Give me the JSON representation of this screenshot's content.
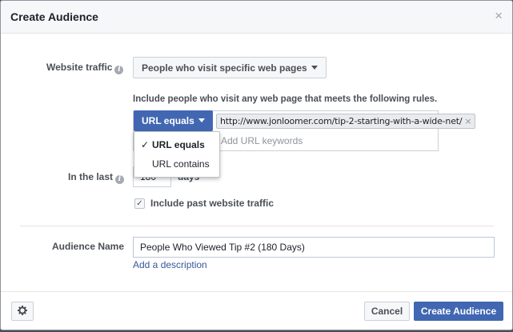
{
  "dialog": {
    "title": "Create Audience",
    "close": "×"
  },
  "website_traffic": {
    "label": "Website traffic",
    "select_value": "People who visit specific web pages"
  },
  "rules": {
    "hint": "Include people who visit any web page that meets the following rules.",
    "operator": "URL equals",
    "url_chip": "http://www.jonloomer.com/tip-2-starting-with-a-wide-net/",
    "chip_remove": "×",
    "keyword_placeholder": "Add URL keywords",
    "dropdown": {
      "options": [
        {
          "label": "URL equals",
          "checked": true
        },
        {
          "label": "URL contains",
          "checked": false
        }
      ]
    }
  },
  "in_the_last": {
    "label": "In the last",
    "value": "180",
    "unit": "days"
  },
  "past_traffic": {
    "label": "Include past website traffic",
    "checked": true
  },
  "audience_name": {
    "label": "Audience Name",
    "value": "People Who Viewed Tip #2 (180 Days)",
    "add_description": "Add a description"
  },
  "footer": {
    "settings_icon": "gear-icon",
    "cancel": "Cancel",
    "create": "Create Audience"
  },
  "colors": {
    "primary": "#4267b2",
    "link": "#365899",
    "header_bg": "#f6f7f9"
  }
}
